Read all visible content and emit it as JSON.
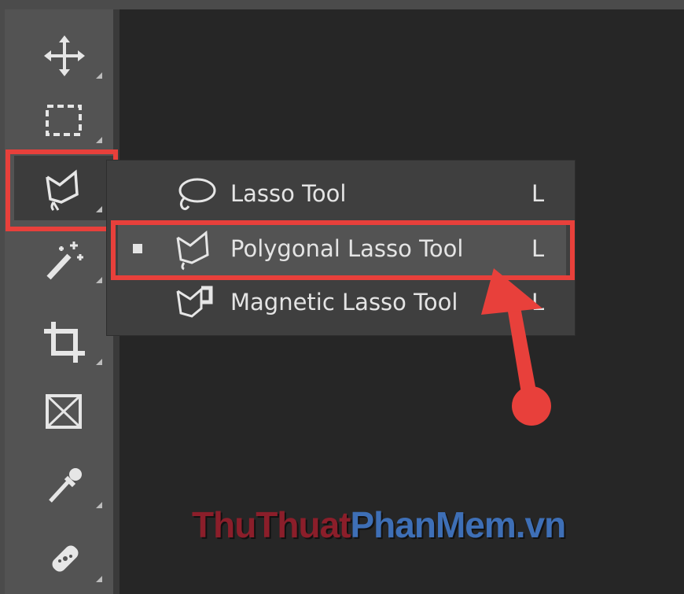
{
  "toolbar": {
    "tools": [
      {
        "name": "Move Tool",
        "icon": "move-icon"
      },
      {
        "name": "Rectangular Marquee Tool",
        "icon": "marquee-icon"
      },
      {
        "name": "Polygonal Lasso Tool",
        "icon": "polygonal-lasso-icon",
        "active": true
      },
      {
        "name": "Magic Wand Tool",
        "icon": "magic-wand-icon"
      },
      {
        "name": "Crop Tool",
        "icon": "crop-icon"
      },
      {
        "name": "Frame Tool",
        "icon": "frame-icon"
      },
      {
        "name": "Eyedropper Tool",
        "icon": "eyedropper-icon"
      },
      {
        "name": "Spot Healing Brush Tool",
        "icon": "healing-brush-icon"
      }
    ]
  },
  "flyout": {
    "items": [
      {
        "label": "Lasso Tool",
        "shortcut": "L",
        "icon": "lasso-icon",
        "selected": false
      },
      {
        "label": "Polygonal Lasso Tool",
        "shortcut": "L",
        "icon": "polygonal-lasso-icon",
        "selected": true
      },
      {
        "label": "Magnetic Lasso Tool",
        "shortcut": "L",
        "icon": "magnetic-lasso-icon",
        "selected": false
      }
    ]
  },
  "watermark": {
    "part1": "ThuThuat",
    "part2": "PhanMem.vn"
  },
  "colors": {
    "highlight": "#e8403b",
    "panel": "#535353",
    "canvas": "#262626"
  }
}
